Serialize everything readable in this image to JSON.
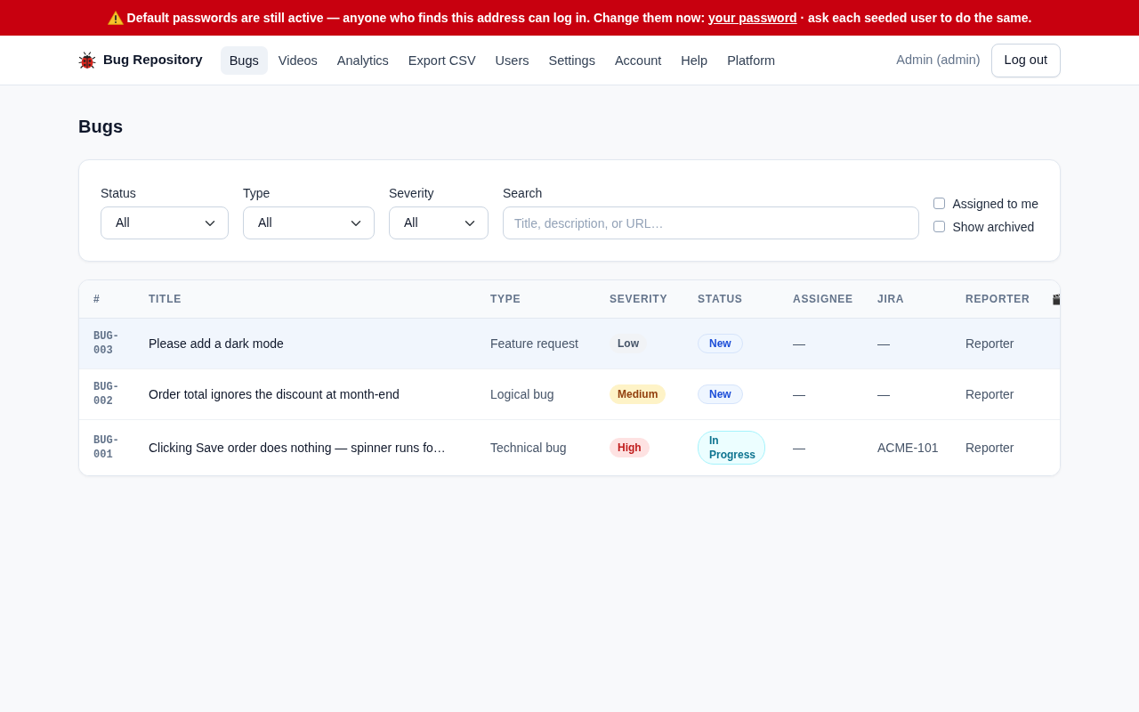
{
  "alert": {
    "text_before": "Default passwords are still active — anyone who finds this address can log in. Change them now: ",
    "link": "your password",
    "text_after": " · ask each seeded user to do the same."
  },
  "brand": "Bug Repository",
  "nav": [
    {
      "label": "Bugs",
      "selected": true
    },
    {
      "label": "Videos",
      "selected": false
    },
    {
      "label": "Analytics",
      "selected": false
    },
    {
      "label": "Export CSV",
      "selected": false
    },
    {
      "label": "Users",
      "selected": false
    },
    {
      "label": "Settings",
      "selected": false
    },
    {
      "label": "Account",
      "selected": false
    },
    {
      "label": "Help",
      "selected": false
    },
    {
      "label": "Platform",
      "selected": false
    }
  ],
  "user": "Admin (admin)",
  "logout": "Log out",
  "page_title": "Bugs",
  "filters": {
    "selects": [
      {
        "label": "Status",
        "value": "All"
      },
      {
        "label": "Type",
        "value": "All"
      },
      {
        "label": "Severity",
        "value": "All"
      }
    ],
    "search": {
      "label": "Search",
      "placeholder": "Title, description, or URL…"
    },
    "checkboxes": [
      {
        "label": "Assigned to me",
        "checked": false
      },
      {
        "label": "Show archived",
        "checked": false
      }
    ]
  },
  "table": {
    "columns": [
      "#",
      "TITLE",
      "TYPE",
      "SEVERITY",
      "STATUS",
      "ASSIGNEE",
      "JIRA",
      "REPORTER"
    ],
    "rows": [
      {
        "id": "BUG-003",
        "title": "Please add a dark mode",
        "type": "Feature request",
        "severity": {
          "text": "Low",
          "kind": "neutral"
        },
        "status": {
          "text": "New",
          "kind": "info"
        },
        "assignee": "—",
        "jira": "—",
        "reporter": "Reporter",
        "selected": true
      },
      {
        "id": "BUG-002",
        "title": "Order total ignores the discount at month-end",
        "type": "Logical bug",
        "severity": {
          "text": "Medium",
          "kind": "warning"
        },
        "status": {
          "text": "New",
          "kind": "info"
        },
        "assignee": "—",
        "jira": "—",
        "reporter": "Reporter",
        "selected": false
      },
      {
        "id": "BUG-001",
        "title": "Clicking Save order does nothing — spinner runs fo…",
        "type": "Technical bug",
        "severity": {
          "text": "High",
          "kind": "danger"
        },
        "status": {
          "text": "In Progress",
          "kind": "accent"
        },
        "assignee": "—",
        "jira": "ACME-101",
        "reporter": "Reporter",
        "selected": false
      }
    ]
  }
}
